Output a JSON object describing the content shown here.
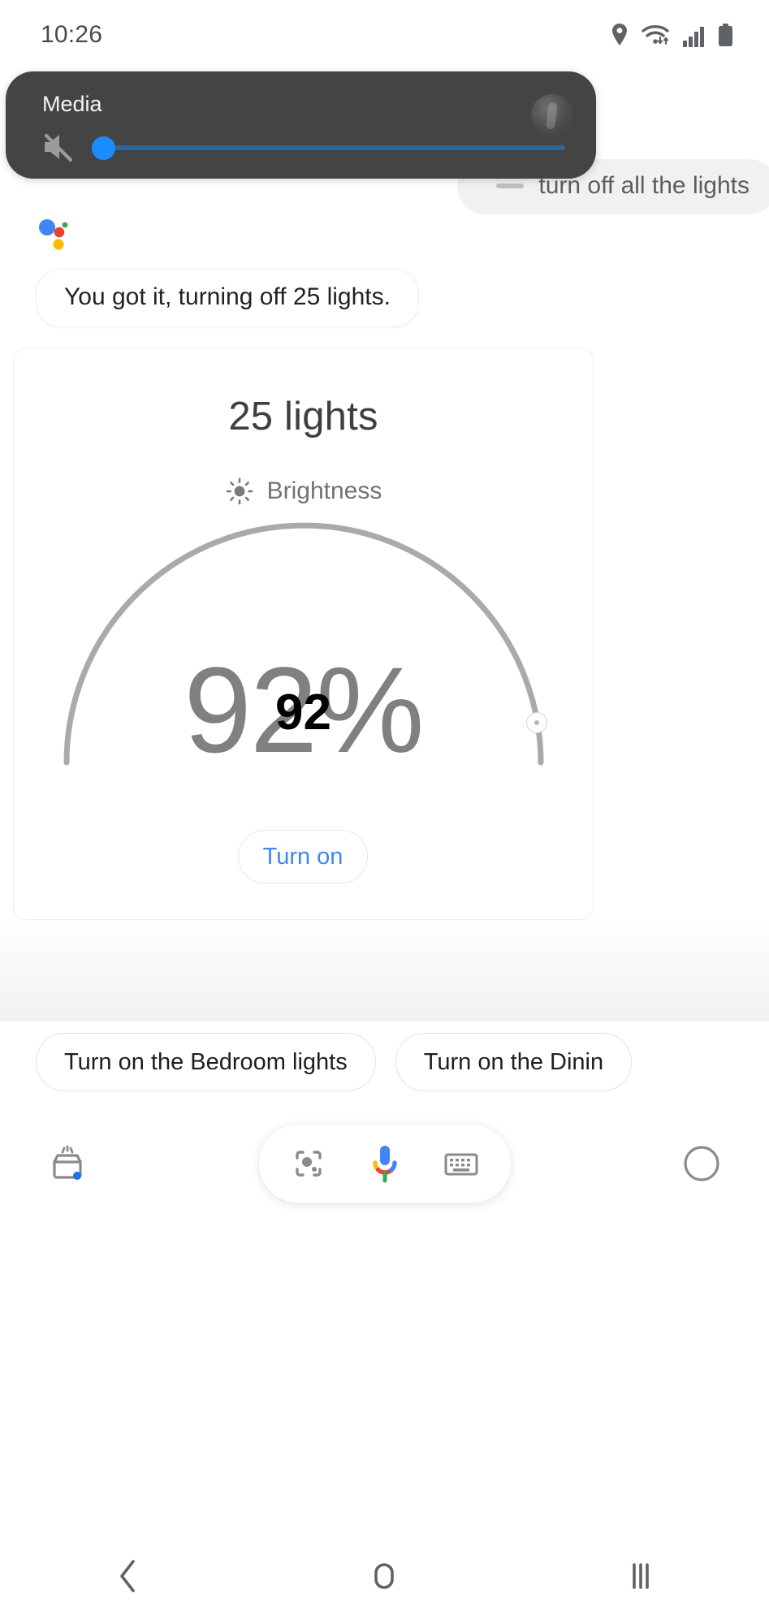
{
  "statusbar": {
    "time": "10:26",
    "icons": [
      "location-pin-icon",
      "wifi-icon",
      "signal-bars-icon",
      "battery-icon"
    ]
  },
  "media_panel": {
    "title": "Media",
    "mute_icon": "volume-mute-icon",
    "avatar": "user-avatar",
    "slider_value": 0,
    "slider_accent": "#1a8cff",
    "track_color": "#2f6699",
    "panel_color": "#444444"
  },
  "conversation": {
    "user_query": "turn off all the lights",
    "assistant_logo": "google-assistant-logo",
    "assistant_reply": "You got it, turning off 25 lights."
  },
  "brightness_card": {
    "title": "25 lights",
    "brightness_icon": "brightness-sun-icon",
    "brightness_label": "Brightness",
    "percent_large": "92%",
    "percent_overlay": "92",
    "dial_value": 92,
    "button_label": "Turn on",
    "button_color": "#4285f4",
    "dial_arc_color": "#aaaaaa"
  },
  "suggestions": [
    {
      "label": "Turn on the Bedroom lights"
    },
    {
      "label": "Turn on the Dinin"
    }
  ],
  "action_bar": {
    "left_icon": "assistant-snapshot-icon",
    "lens_icon": "google-lens-icon",
    "mic_icon": "google-mic-icon",
    "keyboard_icon": "keyboard-icon",
    "right_icon": "explore-compass-icon"
  },
  "navbar": {
    "back": "back-chevron-icon",
    "home": "home-circle-icon",
    "recents": "recents-bars-icon"
  },
  "chart_data": {
    "type": "gauge",
    "title": "Brightness",
    "value": 92,
    "unit": "%",
    "range": [
      0,
      100
    ],
    "label": "25 lights"
  }
}
